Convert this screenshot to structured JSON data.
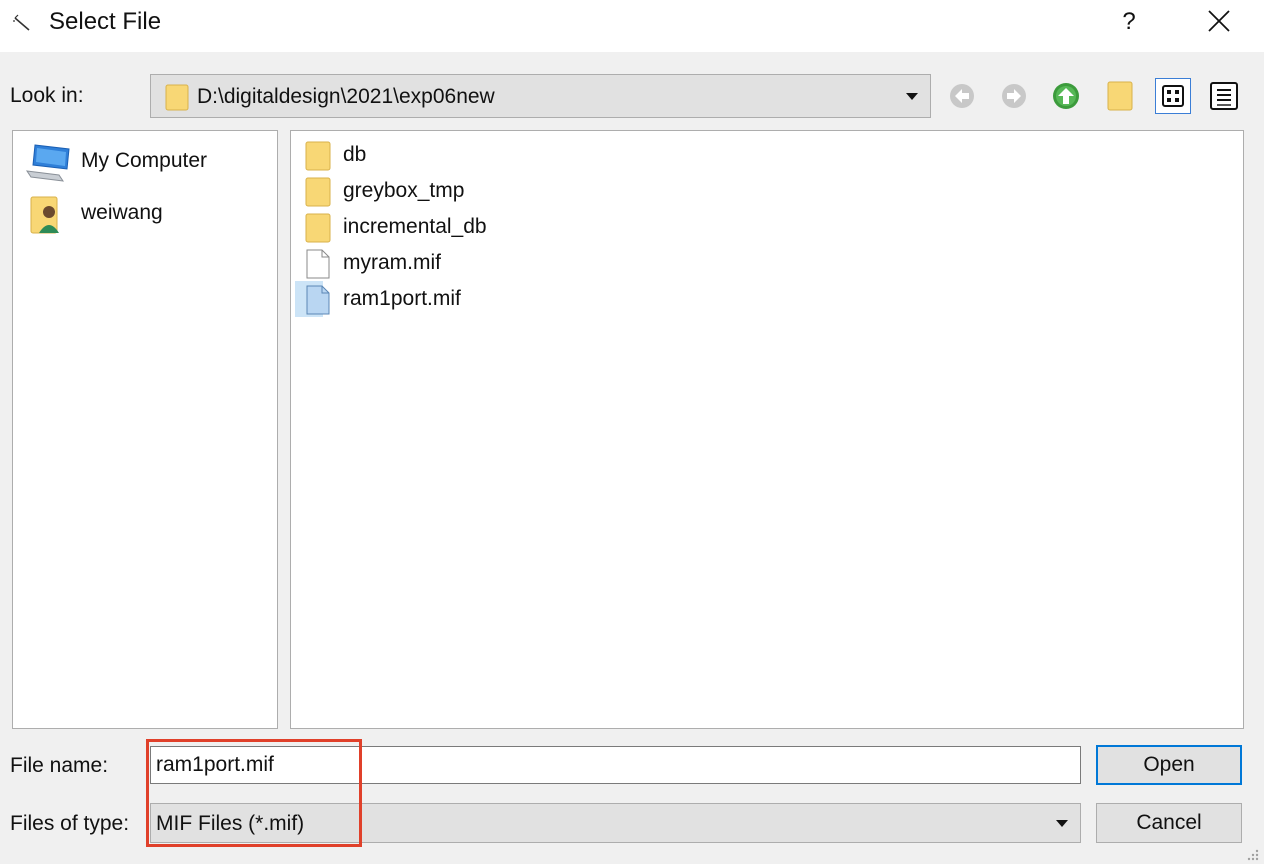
{
  "window": {
    "title": "Select File",
    "help_label": "?"
  },
  "toolbar": {
    "look_in_label": "Look in:",
    "look_in_path": "D:\\digitaldesign\\2021\\exp06new",
    "buttons": [
      "back-icon",
      "forward-icon",
      "parent-folder-icon",
      "new-folder-icon",
      "list-view-icon",
      "detail-view-icon"
    ]
  },
  "sidebar": {
    "items": [
      {
        "label": "My Computer",
        "icon": "computer-icon"
      },
      {
        "label": "weiwang",
        "icon": "user-folder-icon"
      }
    ]
  },
  "files": {
    "items": [
      {
        "name": "db",
        "type": "folder"
      },
      {
        "name": "greybox_tmp",
        "type": "folder"
      },
      {
        "name": "incremental_db",
        "type": "folder"
      },
      {
        "name": "myram.mif",
        "type": "file"
      },
      {
        "name": "ram1port.mif",
        "type": "file",
        "selected": true
      }
    ]
  },
  "bottom": {
    "file_name_label": "File name:",
    "file_name_value": "ram1port.mif",
    "file_type_label": "Files of type:",
    "file_type_value": "MIF Files (*.mif)",
    "open_label": "Open",
    "cancel_label": "Cancel"
  },
  "colors": {
    "selection": "#cce4f7",
    "accent": "#0078d7",
    "highlight_box": "#e0402a",
    "folder": "#f8d775"
  }
}
